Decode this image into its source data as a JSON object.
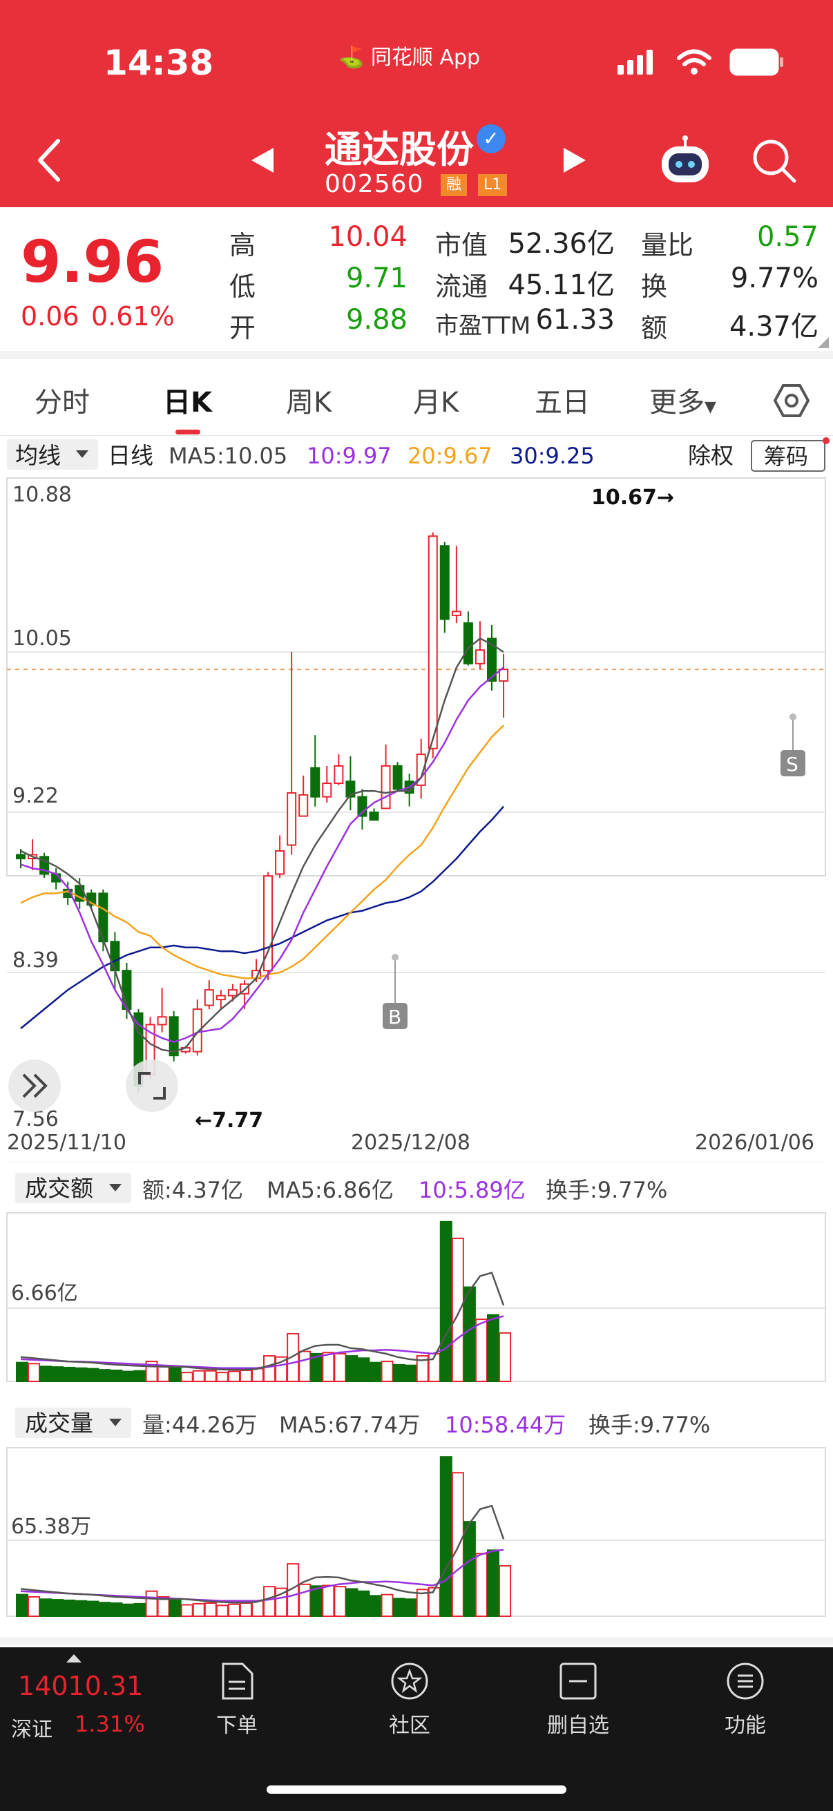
{
  "status": {
    "time": "14:38",
    "app": "同花顺 App"
  },
  "header": {
    "name": "通达股份",
    "code": "002560",
    "tags": [
      "融",
      "L1"
    ]
  },
  "quote": {
    "price": "9.96",
    "change": "0.06",
    "change_pct": "0.61%",
    "cols": [
      [
        {
          "label": "高",
          "value": "10.04",
          "c": "red"
        },
        {
          "label": "低",
          "value": "9.71",
          "c": "green"
        },
        {
          "label": "开",
          "value": "9.88",
          "c": "green"
        }
      ],
      [
        {
          "label": "市值",
          "value": "52.36亿",
          "c": "black"
        },
        {
          "label": "流通",
          "value": "45.11亿",
          "c": "black"
        },
        {
          "label": "市盈TTM",
          "value": "61.33",
          "c": "black"
        }
      ],
      [
        {
          "label": "量比",
          "value": "0.57",
          "c": "green"
        },
        {
          "label": "换",
          "value": "9.77%",
          "c": "black"
        },
        {
          "label": "额",
          "value": "4.37亿",
          "c": "black"
        }
      ]
    ]
  },
  "tabs": [
    "分时",
    "日K",
    "周K",
    "月K",
    "五日",
    "更多",
    "⬡"
  ],
  "indicator": {
    "selector": "均线",
    "line_type": "日线",
    "ma5": "MA5:10.05",
    "ma10": "10:9.97",
    "ma20": "20:9.67",
    "ma30": "30:9.25",
    "btn_fq": "除权",
    "btn_chip": "筹码"
  },
  "kchart": {
    "y_labels": [
      "10.88",
      "10.05",
      "9.22",
      "8.39",
      "7.56"
    ],
    "x_labels": [
      "2025/11/10",
      "2025/12/08",
      "2026/01/06"
    ],
    "high_note": "10.67→",
    "low_note": "←7.77",
    "buy_mark": "B",
    "sell_mark": "S",
    "colors": {
      "up": "#e8232d",
      "down": "#0a6e0a",
      "ma5": "#555555",
      "ma10": "#9b30e0",
      "ma20": "#f2a31a",
      "ma30": "#0b1a8c"
    }
  },
  "amount_panel": {
    "selector": "成交额",
    "value": "额:4.37亿",
    "ma5": "MA5:6.86亿",
    "ma10": "10:5.89亿",
    "turnover": "换手:9.77%",
    "ref": "6.66亿"
  },
  "volume_panel": {
    "selector": "成交量",
    "value": "量:44.26万",
    "ma5": "MA5:67.74万",
    "ma10": "10:58.44万",
    "turnover": "换手:9.77%",
    "ref": "65.38万"
  },
  "bottom": {
    "index_value": "14010.31",
    "index_name": "深证",
    "index_pct": "1.31%",
    "items": [
      "下单",
      "社区",
      "删自选",
      "功能"
    ]
  },
  "chart_data": {
    "type": "candlestick",
    "dates_shown": [
      "2025/11/10",
      "2025/12/08",
      "2026/01/06"
    ],
    "ylim": [
      7.56,
      10.88
    ],
    "candles": [
      {
        "o": 9.0,
        "h": 9.03,
        "l": 8.93,
        "c": 8.98
      },
      {
        "o": 8.98,
        "h": 9.08,
        "l": 8.92,
        "c": 9.0
      },
      {
        "o": 8.99,
        "h": 9.01,
        "l": 8.88,
        "c": 8.9
      },
      {
        "o": 8.9,
        "h": 8.93,
        "l": 8.82,
        "c": 8.86
      },
      {
        "o": 8.82,
        "h": 8.86,
        "l": 8.74,
        "c": 8.78
      },
      {
        "o": 8.84,
        "h": 8.88,
        "l": 8.72,
        "c": 8.76
      },
      {
        "o": 8.8,
        "h": 8.82,
        "l": 8.72,
        "c": 8.74
      },
      {
        "o": 8.8,
        "h": 8.82,
        "l": 8.5,
        "c": 8.55
      },
      {
        "o": 8.55,
        "h": 8.6,
        "l": 8.3,
        "c": 8.4
      },
      {
        "o": 8.4,
        "h": 8.44,
        "l": 8.15,
        "c": 8.2
      },
      {
        "o": 8.18,
        "h": 8.2,
        "l": 7.77,
        "c": 7.8
      },
      {
        "o": 7.86,
        "h": 8.16,
        "l": 7.84,
        "c": 8.12
      },
      {
        "o": 8.12,
        "h": 8.31,
        "l": 8.08,
        "c": 8.16
      },
      {
        "o": 8.16,
        "h": 8.19,
        "l": 7.93,
        "c": 7.96
      },
      {
        "o": 7.98,
        "h": 8.01,
        "l": 7.97,
        "c": 8.0
      },
      {
        "o": 7.98,
        "h": 8.25,
        "l": 7.96,
        "c": 8.2
      },
      {
        "o": 8.22,
        "h": 8.35,
        "l": 8.2,
        "c": 8.3
      },
      {
        "o": 8.25,
        "h": 8.3,
        "l": 8.2,
        "c": 8.27
      },
      {
        "o": 8.27,
        "h": 8.33,
        "l": 8.24,
        "c": 8.3
      },
      {
        "o": 8.28,
        "h": 8.35,
        "l": 8.2,
        "c": 8.33
      },
      {
        "o": 8.36,
        "h": 8.46,
        "l": 8.34,
        "c": 8.4
      },
      {
        "o": 8.4,
        "h": 8.91,
        "l": 8.35,
        "c": 8.89
      },
      {
        "o": 8.9,
        "h": 9.1,
        "l": 8.88,
        "c": 9.02
      },
      {
        "o": 9.05,
        "h": 10.05,
        "l": 9.0,
        "c": 9.32
      },
      {
        "o": 9.2,
        "h": 9.41,
        "l": 9.2,
        "c": 9.31
      },
      {
        "o": 9.45,
        "h": 9.62,
        "l": 9.25,
        "c": 9.3
      },
      {
        "o": 9.3,
        "h": 9.46,
        "l": 9.27,
        "c": 9.37
      },
      {
        "o": 9.37,
        "h": 9.52,
        "l": 9.36,
        "c": 9.46
      },
      {
        "o": 9.38,
        "h": 9.51,
        "l": 9.23,
        "c": 9.3
      },
      {
        "o": 9.3,
        "h": 9.34,
        "l": 9.13,
        "c": 9.2
      },
      {
        "o": 9.22,
        "h": 9.24,
        "l": 9.18,
        "c": 9.18
      },
      {
        "o": 9.24,
        "h": 9.57,
        "l": 9.24,
        "c": 9.46
      },
      {
        "o": 9.46,
        "h": 9.48,
        "l": 9.33,
        "c": 9.34
      },
      {
        "o": 9.38,
        "h": 9.42,
        "l": 9.25,
        "c": 9.32
      },
      {
        "o": 9.36,
        "h": 9.6,
        "l": 9.29,
        "c": 9.52
      },
      {
        "o": 9.55,
        "h": 10.67,
        "l": 9.5,
        "c": 10.65
      },
      {
        "o": 10.6,
        "h": 10.62,
        "l": 10.15,
        "c": 10.22
      },
      {
        "o": 10.24,
        "h": 10.6,
        "l": 10.2,
        "c": 10.26
      },
      {
        "o": 10.2,
        "h": 10.26,
        "l": 9.98,
        "c": 9.99
      },
      {
        "o": 9.99,
        "h": 10.21,
        "l": 9.96,
        "c": 10.06
      },
      {
        "o": 10.12,
        "h": 10.19,
        "l": 9.85,
        "c": 9.9
      },
      {
        "o": 9.9,
        "h": 10.04,
        "l": 9.71,
        "c": 9.96
      }
    ],
    "ma5": [
      9.02,
      8.99,
      8.97,
      8.94,
      8.9,
      8.85,
      8.72,
      8.56,
      8.4,
      8.22,
      8.08,
      8.02,
      7.99,
      7.98,
      8.0,
      8.08,
      8.14,
      8.2,
      8.25,
      8.3,
      8.36,
      8.5,
      8.65,
      8.8,
      8.94,
      9.05,
      9.14,
      9.23,
      9.31,
      9.33,
      9.33,
      9.32,
      9.33,
      9.33,
      9.4,
      9.6,
      9.8,
      9.97,
      10.07,
      10.12,
      10.09,
      10.05
    ],
    "ma10": [
      8.95,
      8.93,
      8.92,
      8.9,
      8.83,
      8.7,
      8.55,
      8.43,
      8.3,
      8.2,
      8.12,
      8.08,
      8.05,
      8.03,
      8.05,
      8.08,
      8.09,
      8.1,
      8.15,
      8.22,
      8.3,
      8.38,
      8.46,
      8.56,
      8.7,
      8.82,
      8.94,
      9.05,
      9.16,
      9.22,
      9.27,
      9.3,
      9.33,
      9.35,
      9.4,
      9.48,
      9.58,
      9.7,
      9.8,
      9.87,
      9.92,
      9.97
    ],
    "ma20": [
      8.75,
      8.78,
      8.8,
      8.8,
      8.81,
      8.78,
      8.75,
      8.72,
      8.68,
      8.65,
      8.6,
      8.58,
      8.52,
      8.48,
      8.45,
      8.42,
      8.4,
      8.38,
      8.37,
      8.36,
      8.36,
      8.38,
      8.39,
      8.42,
      8.46,
      8.52,
      8.58,
      8.64,
      8.7,
      8.76,
      8.82,
      8.87,
      8.94,
      9.0,
      9.05,
      9.14,
      9.25,
      9.35,
      9.45,
      9.53,
      9.61,
      9.67
    ],
    "ma30": [
      8.1,
      8.15,
      8.2,
      8.25,
      8.3,
      8.34,
      8.38,
      8.42,
      8.45,
      8.48,
      8.5,
      8.52,
      8.52,
      8.53,
      8.52,
      8.52,
      8.51,
      8.5,
      8.5,
      8.49,
      8.5,
      8.52,
      8.54,
      8.57,
      8.6,
      8.63,
      8.66,
      8.68,
      8.7,
      8.71,
      8.73,
      8.75,
      8.76,
      8.78,
      8.81,
      8.86,
      8.92,
      8.98,
      9.05,
      9.12,
      9.18,
      9.25
    ],
    "amount_yi": [
      1.7,
      1.6,
      1.35,
      1.3,
      1.25,
      1.2,
      1.15,
      1.05,
      1.0,
      0.9,
      0.95,
      1.8,
      1.4,
      1.2,
      0.8,
      0.95,
      0.95,
      0.8,
      0.9,
      1.0,
      1.15,
      2.3,
      2.2,
      4.3,
      2.7,
      2.5,
      2.6,
      2.5,
      2.3,
      2.1,
      1.7,
      1.8,
      1.5,
      1.45,
      2.3,
      2.5,
      14.4,
      12.9,
      8.5,
      5.6,
      6.0,
      4.37
    ],
    "amount_ma5": [
      2.2,
      2.1,
      2.0,
      1.9,
      1.8,
      1.75,
      1.7,
      1.6,
      1.5,
      1.45,
      1.4,
      1.35,
      1.33,
      1.3,
      1.3,
      1.2,
      1.1,
      1.08,
      1.05,
      1.05,
      1.1,
      1.4,
      1.7,
      2.2,
      2.8,
      3.2,
      3.3,
      3.3,
      3.0,
      2.9,
      2.7,
      2.5,
      2.2,
      2.0,
      1.9,
      2.0,
      4.0,
      5.8,
      8.0,
      9.5,
      9.8,
      6.86
    ],
    "amount_ma10": [
      2.0,
      1.95,
      1.9,
      1.85,
      1.8,
      1.78,
      1.75,
      1.7,
      1.65,
      1.6,
      1.55,
      1.5,
      1.45,
      1.4,
      1.35,
      1.3,
      1.25,
      1.2,
      1.2,
      1.2,
      1.2,
      1.3,
      1.45,
      1.65,
      1.9,
      2.2,
      2.4,
      2.6,
      2.7,
      2.8,
      2.8,
      2.85,
      2.8,
      2.7,
      2.6,
      2.5,
      2.9,
      3.8,
      4.6,
      5.2,
      5.6,
      5.89
    ],
    "volume_wan": [
      19,
      17,
      15,
      14.5,
      14,
      13.5,
      13,
      12,
      11.5,
      10.5,
      11,
      22,
      17,
      14.5,
      10,
      11,
      11.5,
      9.5,
      10.5,
      11.5,
      13.5,
      26,
      24.5,
      46,
      28,
      26.5,
      27,
      26,
      24,
      22,
      18,
      19,
      15.5,
      15,
      23.5,
      25,
      140,
      126,
      83,
      55,
      58,
      44.26
    ],
    "volume_ma5": [
      24,
      23,
      22,
      21,
      20,
      19.5,
      19,
      18,
      17,
      16.5,
      16,
      15.5,
      15,
      15,
      15,
      14,
      13,
      12.5,
      12,
      12,
      12.5,
      15.5,
      19,
      24,
      30,
      34,
      34.5,
      34,
      31.5,
      30,
      28,
      26,
      23,
      21,
      20,
      21,
      40,
      58,
      80,
      94,
      97,
      67.74
    ],
    "volume_ma10": [
      22,
      21.5,
      21,
      20.5,
      20,
      19.5,
      19,
      18.5,
      18,
      17.5,
      17,
      16.5,
      16,
      15.5,
      15,
      14.5,
      14,
      13.5,
      13.5,
      13.5,
      13.5,
      14.5,
      16,
      18,
      21,
      24,
      26,
      28,
      29,
      30,
      30,
      30.5,
      30,
      29,
      28,
      27,
      31,
      40,
      48,
      54,
      57,
      58.44
    ]
  }
}
